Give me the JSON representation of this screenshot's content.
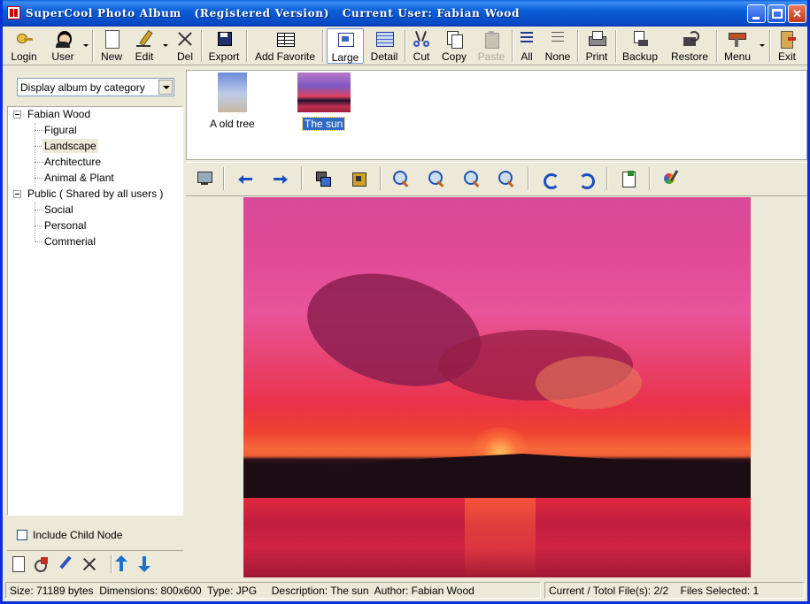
{
  "window": {
    "title": "SuperCool Photo Album   (Registered Version)   Current User: Fabian Wood"
  },
  "toolbar": {
    "login": "Login",
    "user": "User",
    "new": "New",
    "edit": "Edit",
    "del": "Del",
    "export": "Export",
    "add_favorite": "Add Favorite",
    "large": "Large",
    "detail": "Detail",
    "cut": "Cut",
    "copy": "Copy",
    "paste": "Paste",
    "all": "All",
    "none": "None",
    "print": "Print",
    "backup": "Backup",
    "restore": "Restore",
    "menu": "Menu",
    "exit": "Exit"
  },
  "sidebar": {
    "display_mode": "Display album by category",
    "tree": [
      {
        "label": "Fabian Wood",
        "level": 0
      },
      {
        "label": "Figural",
        "level": 1
      },
      {
        "label": "Landscape",
        "level": 1,
        "selected": true
      },
      {
        "label": "Architecture",
        "level": 1
      },
      {
        "label": "Animal & Plant",
        "level": 1
      },
      {
        "label": "Public ( Shared by all users )",
        "level": 0
      },
      {
        "label": "Social",
        "level": 1
      },
      {
        "label": "Personal",
        "level": 1
      },
      {
        "label": "Commerial",
        "level": 1
      }
    ],
    "include_child_node": "Include Child Node",
    "include_child_checked": false
  },
  "thumbnails": [
    {
      "caption": "A old tree",
      "selected": false
    },
    {
      "caption": "The sun",
      "selected": true
    }
  ],
  "status": {
    "size": "Size: 71189 bytes",
    "dimensions": "Dimensions: 800x600",
    "type": "Type: JPG",
    "description": "Description: The sun",
    "author": "Author: Fabian Wood",
    "current_total": "Current / Totol File(s): 2/2",
    "files_selected": "Files Selected: 1"
  },
  "colors": {
    "title_bar": "#0a5fd8",
    "selection": "#316ac5",
    "window_bg": "#ece9d8"
  }
}
